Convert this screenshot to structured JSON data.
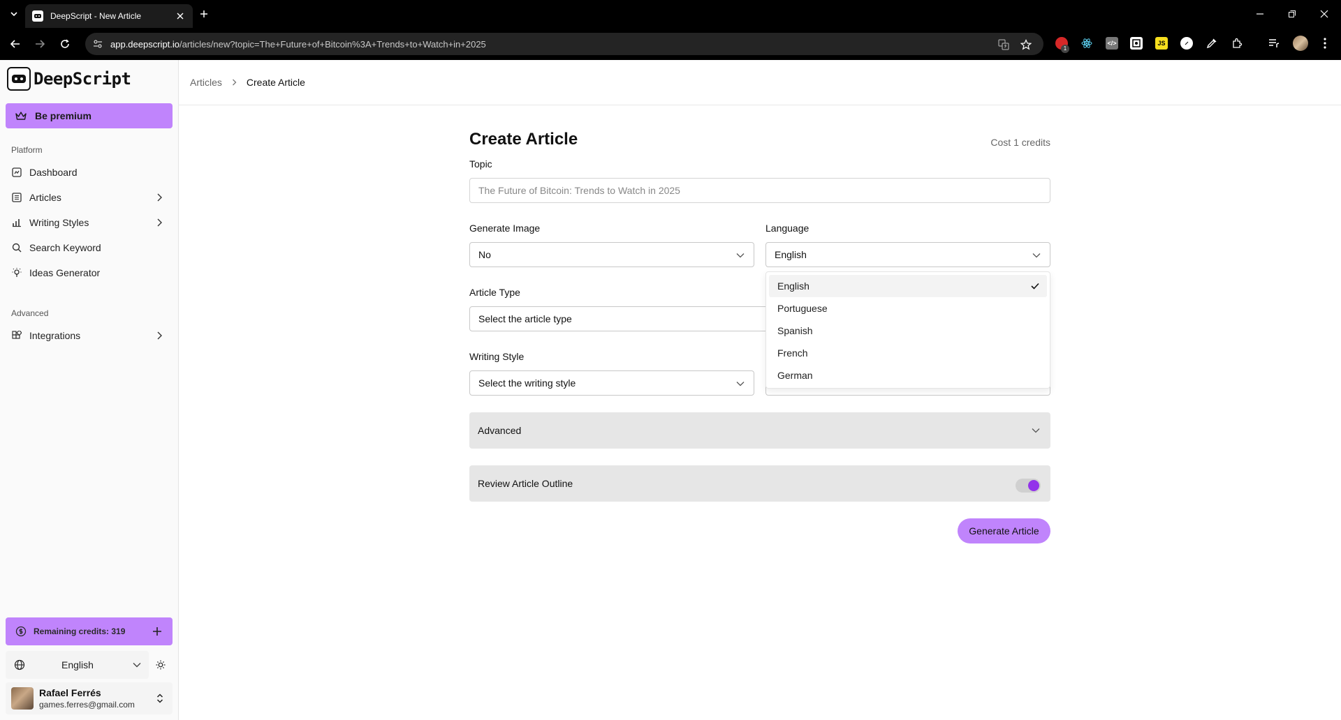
{
  "browser": {
    "tab_title": "DeepScript - New Article",
    "url_host": "app.deepscript.io",
    "url_path": "/articles/new?topic=The+Future+of+Bitcoin%3A+Trends+to+Watch+in+2025",
    "extension_badge": "1"
  },
  "sidebar": {
    "brand": "DeepScript",
    "premium_label": "Be premium",
    "section_platform": "Platform",
    "section_advanced": "Advanced",
    "items": [
      {
        "label": "Dashboard"
      },
      {
        "label": "Articles"
      },
      {
        "label": "Writing Styles"
      },
      {
        "label": "Search Keyword"
      },
      {
        "label": "Ideas Generator"
      },
      {
        "label": "Integrations"
      }
    ],
    "credits_label": "Remaining credits: 319",
    "language": "English",
    "user": {
      "name": "Rafael Ferrés",
      "email": "games.ferres@gmail.com"
    }
  },
  "breadcrumb": {
    "parent": "Articles",
    "current": "Create Article"
  },
  "form": {
    "title": "Create Article",
    "cost": "Cost 1 credits",
    "topic_label": "Topic",
    "topic_placeholder": "The Future of Bitcoin: Trends to Watch in 2025",
    "generate_image_label": "Generate Image",
    "generate_image_value": "No",
    "language_label": "Language",
    "language_value": "English",
    "article_type_label": "Article Type",
    "article_type_value": "Select the article type",
    "writing_style_label": "Writing Style",
    "writing_style_value": "Select the writing style",
    "advanced_label": "Advanced",
    "review_label": "Review Article Outline",
    "review_enabled": true,
    "submit_label": "Generate Article"
  },
  "language_dropdown": {
    "options": [
      "English",
      "Portuguese",
      "Spanish",
      "French",
      "German"
    ],
    "selected": "English"
  },
  "colors": {
    "accent": "#c084fc",
    "toggle_on": "#9333ea"
  }
}
